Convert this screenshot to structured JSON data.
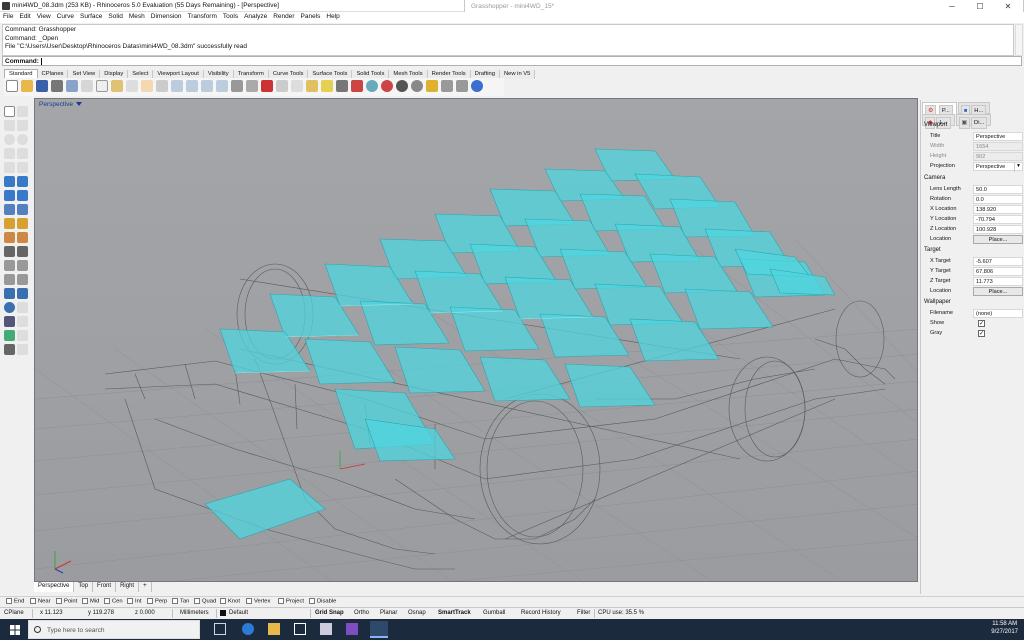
{
  "window": {
    "title": "mini4WD_08.3dm (253 KB) - Rhinoceros 5.0 Evaluation (55 Days Remaining) - [Perspective]",
    "gh_title": "Grasshopper - mini4WD_15*"
  },
  "menu": [
    "File",
    "Edit",
    "View",
    "Curve",
    "Surface",
    "Solid",
    "Mesh",
    "Dimension",
    "Transform",
    "Tools",
    "Analyze",
    "Render",
    "Panels",
    "Help"
  ],
  "command_history": [
    "Command: Grasshopper",
    "Command: _Open",
    "File \"C:\\Users\\User\\Desktop\\Rhinoceros Datas\\mini4WD_08.3dm\" successfully read"
  ],
  "command_prompt": "Command:",
  "toolbar_tabs": [
    "Standard",
    "CPlanes",
    "Set View",
    "Display",
    "Select",
    "Viewport Layout",
    "Visibility",
    "Transform",
    "Curve Tools",
    "Surface Tools",
    "Solid Tools",
    "Mesh Tools",
    "Render Tools",
    "Drafting",
    "New in V5"
  ],
  "viewport": {
    "label": "Perspective"
  },
  "viewport_tabs": [
    "Perspective",
    "Top",
    "Front",
    "Right",
    "+"
  ],
  "osnaps": [
    "End",
    "Near",
    "Point",
    "Mid",
    "Cen",
    "Int",
    "Perp",
    "Tan",
    "Quad",
    "Knot",
    "Vertex",
    "Project",
    "Disable"
  ],
  "status": {
    "cplane": "CPlane",
    "x": "x 11.123",
    "y": "y 119.278",
    "z": "z 0.000",
    "units": "Millimeters",
    "layer": "Default",
    "grid_snap": "Grid Snap",
    "ortho": "Ortho",
    "planar": "Planar",
    "osnap": "Osnap",
    "smarttrack": "SmartTrack",
    "gumball": "Gumball",
    "record_history": "Record History",
    "filter": "Filter",
    "cpu": "CPU use: 35.5 %"
  },
  "panel": {
    "tabs": [
      "P...",
      "H...",
      "L...",
      "Di..."
    ],
    "viewport_section": "Viewport",
    "rows_viewport": [
      {
        "label": "Title",
        "value": "Perspective",
        "disabled": false
      },
      {
        "label": "Width",
        "value": "1654",
        "disabled": true
      },
      {
        "label": "Height",
        "value": "902",
        "disabled": true
      },
      {
        "label": "Projection",
        "value": "Perspective",
        "disabled": false
      }
    ],
    "camera_section": "Camera",
    "rows_camera": [
      {
        "label": "Lens Length",
        "value": "50.0"
      },
      {
        "label": "Rotation",
        "value": "0.0"
      },
      {
        "label": "X Location",
        "value": "138.920"
      },
      {
        "label": "Y Location",
        "value": "-70.794"
      },
      {
        "label": "Z Location",
        "value": "100.928"
      }
    ],
    "location_label": "Location",
    "place_label": "Place...",
    "target_section": "Target",
    "rows_target": [
      {
        "label": "X Target",
        "value": "-5.607"
      },
      {
        "label": "Y Target",
        "value": "67.806"
      },
      {
        "label": "Z Target",
        "value": "11.773"
      }
    ],
    "wallpaper_section": "Wallpaper",
    "filename_label": "Filename",
    "filename_value": "(none)",
    "show_label": "Show",
    "gray_label": "Gray"
  },
  "taskbar": {
    "search_placeholder": "Type here to search",
    "time": "11:58 AM",
    "date": "9/27/2017"
  },
  "colors": {
    "viewport_bg": "#9fa1a5",
    "plate_fill": "#4fd6df",
    "plate_stroke": "#2aa6b0",
    "wire": "#5a5a5a",
    "taskbar": "#1b2a3c"
  }
}
